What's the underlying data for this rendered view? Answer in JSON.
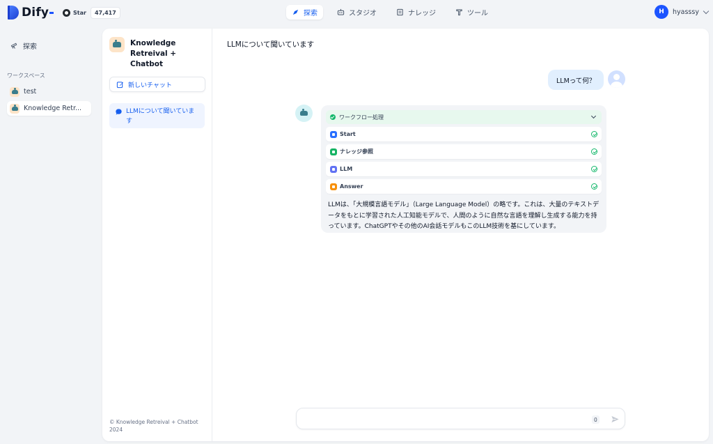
{
  "app": {
    "logo_text": "Dify",
    "github": {
      "label": "Star",
      "count": "47,417"
    }
  },
  "nav": [
    {
      "label": "探索",
      "icon": "explore-icon",
      "active": true
    },
    {
      "label": "スタジオ",
      "icon": "studio-icon",
      "active": false
    },
    {
      "label": "ナレッジ",
      "icon": "knowledge-icon",
      "active": false
    },
    {
      "label": "ツール",
      "icon": "tools-icon",
      "active": false
    }
  ],
  "user": {
    "initial": "H",
    "name": "hyasssy"
  },
  "sidebar": {
    "explore_label": "探索",
    "workspace_title": "ワークスペース",
    "items": [
      {
        "label": "test",
        "selected": false
      },
      {
        "label": "Knowledge Retr...",
        "selected": true
      }
    ]
  },
  "chat_list": {
    "app_title": "Knowledge Retreival + Chatbot",
    "new_chat_label": "新しいチャット",
    "conversations": [
      {
        "title": "LLMについて聞いています",
        "active": true
      }
    ],
    "copyright": "© Knowledge Retreival + Chatbot 2024"
  },
  "chat": {
    "title": "LLMについて聞いています",
    "user_message": "LLMって何？",
    "workflow": {
      "title": "ワークフロー処理",
      "nodes": [
        {
          "label": "Start",
          "color": "#2970ff",
          "status": "success"
        },
        {
          "label": "ナレッジ参照",
          "color": "#16b364",
          "status": "success"
        },
        {
          "label": "LLM",
          "color": "#6172f3",
          "status": "success"
        },
        {
          "label": "Answer",
          "color": "#f79009",
          "status": "success"
        }
      ]
    },
    "answer": "LLMは、「大規模言語モデル」（Large Language Model）の略です。これは、大量のテキストデータをもとに学習された人工知能モデルで、人間のように自然な言語を理解し生成する能力を持っています。ChatGPTやその他のAI会話モデルもこのLLM技術を基にしています。",
    "input": {
      "value": "",
      "placeholder": "",
      "char_count": "0"
    }
  },
  "colors": {
    "accent": "#155eef",
    "success": "#12b76a",
    "user_bubble": "#e1effe"
  }
}
